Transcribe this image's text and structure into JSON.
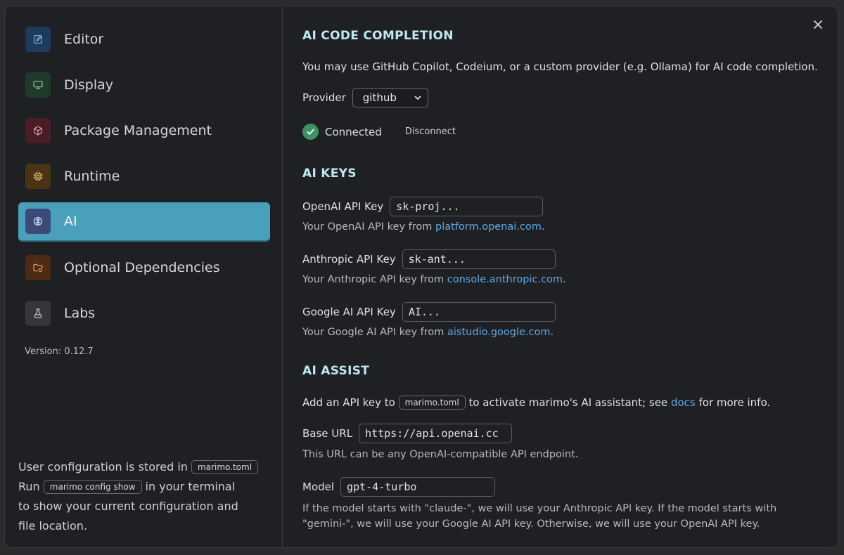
{
  "sidebar": {
    "items": [
      {
        "label": "Editor",
        "icon": "edit-icon",
        "color": "#1e3a5c"
      },
      {
        "label": "Display",
        "icon": "monitor-icon",
        "color": "#1f3a28"
      },
      {
        "label": "Package Management",
        "icon": "package-icon",
        "color": "#4a1d26"
      },
      {
        "label": "Runtime",
        "icon": "cpu-icon",
        "color": "#4a3415"
      },
      {
        "label": "AI",
        "icon": "brain-icon",
        "color": "#3b4a78",
        "active": true
      },
      {
        "label": "Optional Dependencies",
        "icon": "folder-cog-icon",
        "color": "#4d2a14"
      },
      {
        "label": "Labs",
        "icon": "flask-icon",
        "color": "#34363a"
      }
    ],
    "version": "Version: 0.12.7",
    "config_note": {
      "line1_prefix": "User configuration is stored in",
      "file_badge": "marimo.toml",
      "line2_prefix": "Run",
      "command_badge": "marimo config show",
      "line2_suffix": "in your terminal",
      "line3": "to show your current configuration and",
      "line4": "file location."
    }
  },
  "completion": {
    "title": "AI CODE COMPLETION",
    "description": "You may use GitHub Copilot, Codeium, or a custom provider (e.g. Ollama) for AI code completion.",
    "provider_label": "Provider",
    "provider_value": "github",
    "status": "Connected",
    "disconnect_label": "Disconnect"
  },
  "keys": {
    "title": "AI KEYS",
    "openai": {
      "label": "OpenAI API Key",
      "value": "sk-proj...",
      "help_prefix": "Your OpenAI API key from",
      "link": "platform.openai.com",
      "help_suffix": "."
    },
    "anthropic": {
      "label": "Anthropic API Key",
      "value": "sk-ant...",
      "help_prefix": "Your Anthropic API key from",
      "link": "console.anthropic.com",
      "help_suffix": "."
    },
    "google": {
      "label": "Google AI API Key",
      "value": "AI...",
      "help_prefix": "Your Google AI API key from",
      "link": "aistudio.google.com",
      "help_suffix": "."
    }
  },
  "assist": {
    "title": "AI ASSIST",
    "intro_prefix": "Add an API key to",
    "intro_badge": "marimo.toml",
    "intro_middle": "to activate marimo's AI assistant; see",
    "intro_link": "docs",
    "intro_suffix": "for more info.",
    "base_url_label": "Base URL",
    "base_url_value": "https://api.openai.cc",
    "base_url_help": "This URL can be any OpenAI-compatible API endpoint.",
    "model_label": "Model",
    "model_value": "gpt-4-turbo",
    "model_help": "If the model starts with \"claude-\", we will use your Anthropic API key. If the model starts with \"gemini-\", we will use your Google AI API key. Otherwise, we will use your OpenAI API key."
  },
  "colors": {
    "accent": "#4aa0bb",
    "section_title": "#bfe7f4",
    "link": "#5ea8e6",
    "success": "#3e9163"
  }
}
